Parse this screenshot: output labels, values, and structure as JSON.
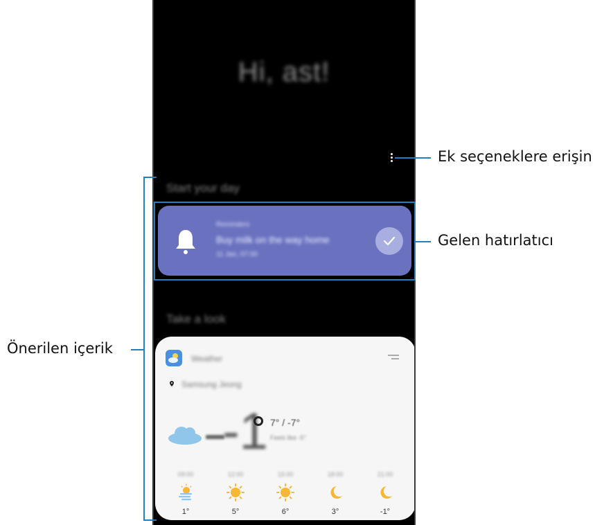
{
  "greeting": "Hi, ast!",
  "sections": {
    "start": "Start your day",
    "look": "Take a look"
  },
  "reminder": {
    "category": "Reminders",
    "title": "Buy milk on the way home",
    "time": "11 Jan, 07:00"
  },
  "weather": {
    "app_name": "Weather",
    "location": "Samsung Jeong",
    "current_temp": "-1",
    "hi_lo": "7° / -7°",
    "feels": "Feels like -5°",
    "hourly": [
      {
        "time": "09:00",
        "icon": "sun-cloud-icon",
        "temp": "1°"
      },
      {
        "time": "12:00",
        "icon": "sun-icon",
        "temp": "5°"
      },
      {
        "time": "15:00",
        "icon": "sun-icon",
        "temp": "6°"
      },
      {
        "time": "18:00",
        "icon": "moon-icon",
        "temp": "3°"
      },
      {
        "time": "21:00",
        "icon": "moon-icon",
        "temp": "-1°"
      }
    ]
  },
  "annotations": {
    "more_options": "Ek seçeneklere erişin",
    "reminder": "Gelen hatırlatıcı",
    "recommended": "Önerilen içerik"
  },
  "colors": {
    "callout": "#1f7fc2",
    "reminder_card": "#6a72c0",
    "weather_card": "#f6f6f6"
  }
}
